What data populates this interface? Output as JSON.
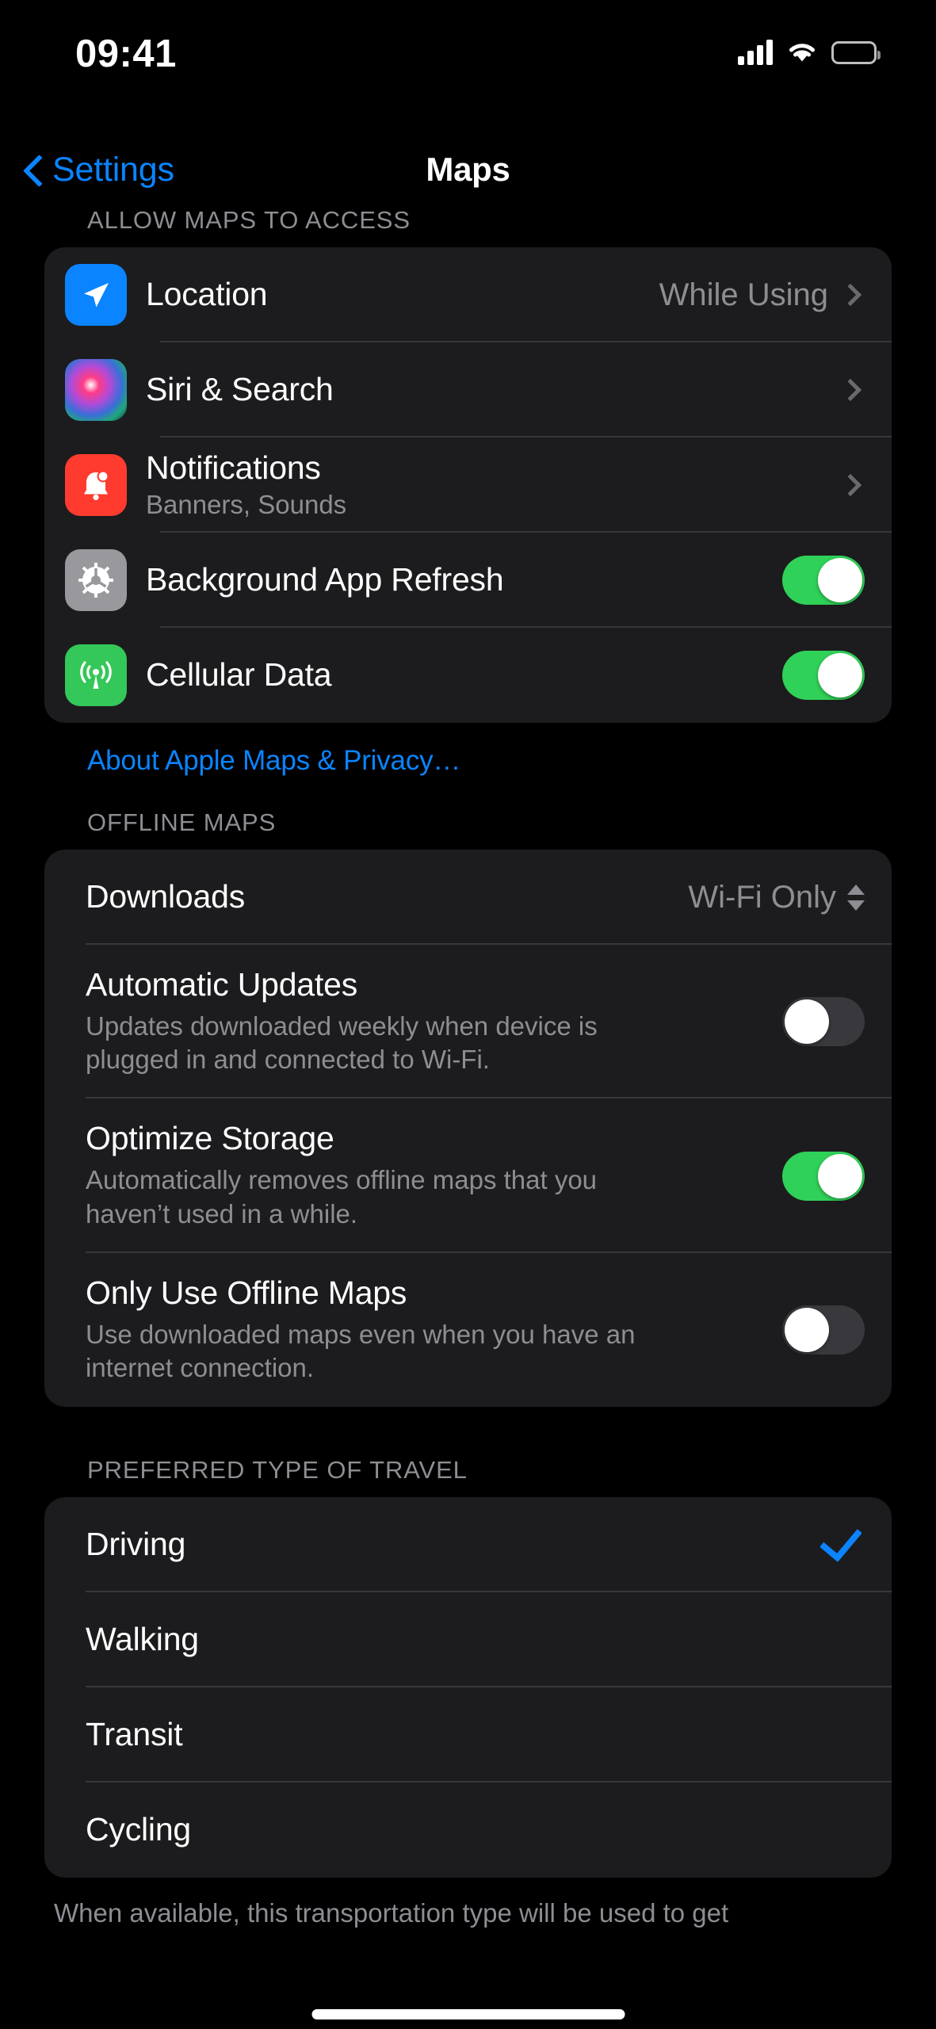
{
  "status_bar": {
    "time": "09:41",
    "cellular_icon": "cellular-bars-icon",
    "wifi_icon": "wifi-icon",
    "battery_icon": "battery-full-icon"
  },
  "nav": {
    "back_label": "Settings",
    "back_icon": "chevron-left-icon",
    "title": "Maps"
  },
  "colors": {
    "accent_blue": "#0A84FF",
    "toggle_on_green": "#30D158",
    "toggle_off_gray": "#39393D",
    "card_bg": "#1C1C1E",
    "page_bg": "#000000",
    "secondary_text": "#8D8D93"
  },
  "sections": [
    {
      "header": "ALLOW MAPS TO ACCESS",
      "rows": [
        {
          "title": "Location",
          "subtitle": "",
          "value": "While Using",
          "icon": "location-arrow-icon",
          "accessory": "chevron"
        },
        {
          "title": "Siri & Search",
          "subtitle": "",
          "value": "",
          "icon": "siri-orb-icon",
          "accessory": "chevron"
        },
        {
          "title": "Notifications",
          "subtitle": "Banners, Sounds",
          "value": "",
          "icon": "notification-bell-icon",
          "accessory": "chevron"
        },
        {
          "title": "Background App Refresh",
          "subtitle": "",
          "value": "",
          "icon": "gear-icon",
          "accessory": "toggle",
          "toggle_on": true
        },
        {
          "title": "Cellular Data",
          "subtitle": "",
          "value": "",
          "icon": "cellular-antenna-icon",
          "accessory": "toggle",
          "toggle_on": true
        }
      ],
      "link": "About Apple Maps & Privacy…"
    },
    {
      "header": "OFFLINE MAPS",
      "rows": [
        {
          "title": "Downloads",
          "description": "",
          "value": "Wi-Fi Only",
          "accessory": "updown"
        },
        {
          "title": "Automatic Updates",
          "description": "Updates downloaded weekly when device is plugged in and connected to Wi-Fi.",
          "value": "",
          "accessory": "toggle",
          "toggle_on": false
        },
        {
          "title": "Optimize Storage",
          "description": "Automatically removes offline maps that you haven’t used in a while.",
          "value": "",
          "accessory": "toggle",
          "toggle_on": true
        },
        {
          "title": "Only Use Offline Maps",
          "description": "Use downloaded maps even when you have an internet connection.",
          "value": "",
          "accessory": "toggle",
          "toggle_on": false
        }
      ]
    },
    {
      "header": "PREFERRED TYPE OF TRAVEL",
      "rows": [
        {
          "title": "Driving",
          "selected": true
        },
        {
          "title": "Walking",
          "selected": false
        },
        {
          "title": "Transit",
          "selected": false
        },
        {
          "title": "Cycling",
          "selected": false
        }
      ],
      "footnote": "When available, this transportation type will be used to get"
    }
  ]
}
